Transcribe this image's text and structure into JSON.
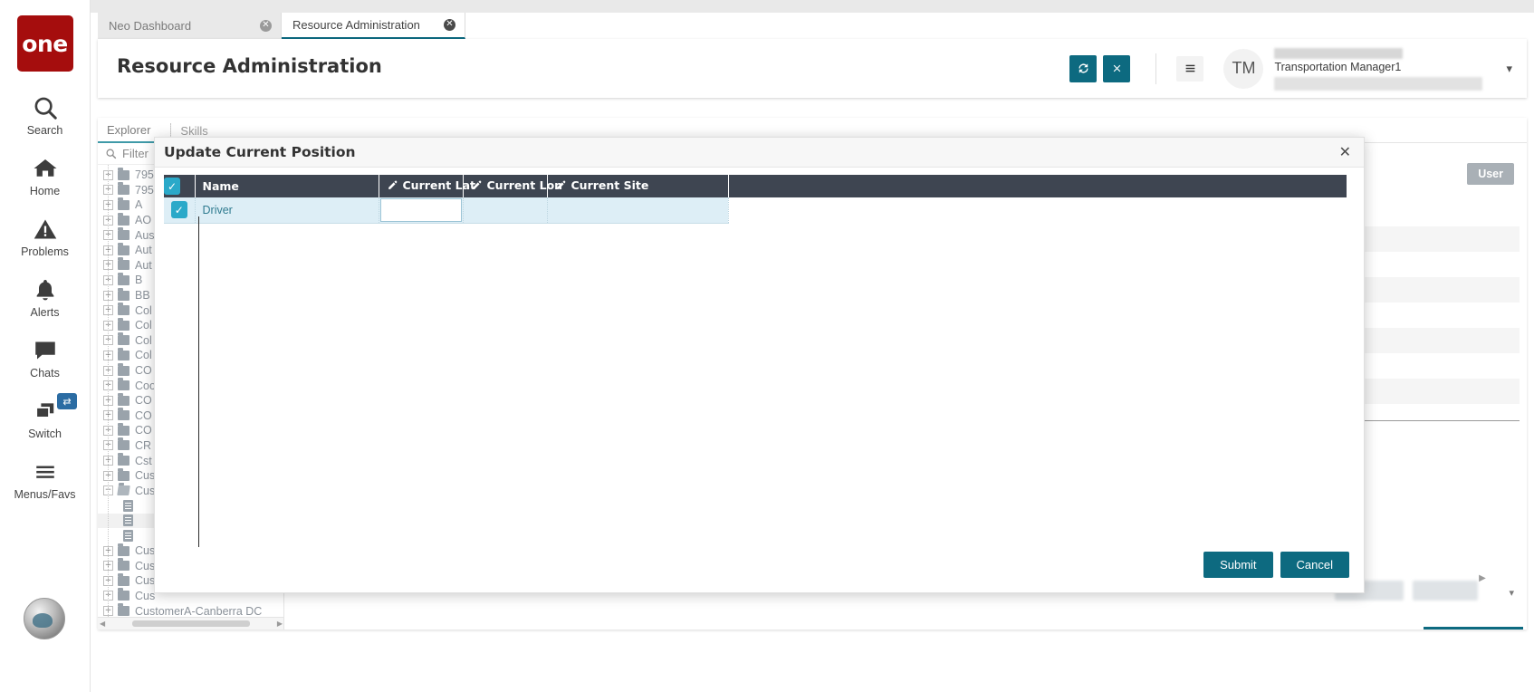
{
  "brand": {
    "logo_text": "one",
    "accent": "#0d6a80",
    "logo_bg": "#a50d0d"
  },
  "rail": {
    "items": [
      {
        "label": "Search",
        "icon": "search-icon"
      },
      {
        "label": "Home",
        "icon": "home-icon"
      },
      {
        "label": "Problems",
        "icon": "warning-icon"
      },
      {
        "label": "Alerts",
        "icon": "bell-icon"
      },
      {
        "label": "Chats",
        "icon": "chat-icon"
      },
      {
        "label": "Switch",
        "icon": "switch-icon",
        "badge": "⇄"
      },
      {
        "label": "Menus/Favs",
        "icon": "hamburger-icon"
      }
    ]
  },
  "tabs": [
    {
      "label": "Neo Dashboard",
      "active": false
    },
    {
      "label": "Resource Administration",
      "active": true
    }
  ],
  "header": {
    "title": "Resource Administration",
    "refresh_label": "↻",
    "close_label": "✕",
    "menu_label": "☰",
    "avatar_initials": "TM",
    "user_name": "Transportation Manager1",
    "caret": "▾"
  },
  "panel_tabs": [
    {
      "label": "Explorer",
      "active": true
    },
    {
      "label": "Skills",
      "active": false
    }
  ],
  "explorer": {
    "filter_placeholder": "Filter",
    "search_icon": "search-icon",
    "nodes": [
      {
        "label": "795",
        "type": "folder",
        "level": 0
      },
      {
        "label": "795",
        "type": "folder",
        "level": 0
      },
      {
        "label": "A",
        "type": "folder",
        "level": 0
      },
      {
        "label": "AO",
        "type": "folder",
        "level": 0
      },
      {
        "label": "Aus",
        "type": "folder",
        "level": 0
      },
      {
        "label": "Aut",
        "type": "folder",
        "level": 0
      },
      {
        "label": "Aut",
        "type": "folder",
        "level": 0
      },
      {
        "label": "B",
        "type": "folder",
        "level": 0
      },
      {
        "label": "BB",
        "type": "folder",
        "level": 0
      },
      {
        "label": "Col",
        "type": "folder",
        "level": 0
      },
      {
        "label": "Col",
        "type": "folder",
        "level": 0
      },
      {
        "label": "Col",
        "type": "folder",
        "level": 0
      },
      {
        "label": "Col",
        "type": "folder",
        "level": 0
      },
      {
        "label": "CO",
        "type": "folder",
        "level": 0
      },
      {
        "label": "Coo",
        "type": "folder",
        "level": 0
      },
      {
        "label": "CO",
        "type": "folder",
        "level": 0
      },
      {
        "label": "CO",
        "type": "folder",
        "level": 0
      },
      {
        "label": "CO",
        "type": "folder",
        "level": 0
      },
      {
        "label": "CR",
        "type": "folder",
        "level": 0
      },
      {
        "label": "Cst",
        "type": "folder",
        "level": 0
      },
      {
        "label": "Cus",
        "type": "folder",
        "level": 0
      },
      {
        "label": "Cus",
        "type": "folder-open",
        "level": 0
      },
      {
        "label": "",
        "type": "document",
        "level": 1
      },
      {
        "label": "",
        "type": "document",
        "level": 1,
        "highlight": true
      },
      {
        "label": "",
        "type": "document",
        "level": 1
      },
      {
        "label": "Cus",
        "type": "folder",
        "level": 0
      },
      {
        "label": "Cus",
        "type": "folder",
        "level": 0
      },
      {
        "label": "Cus",
        "type": "folder",
        "level": 0
      },
      {
        "label": "Cus",
        "type": "folder",
        "level": 0
      },
      {
        "label": "CustomerA-Canberra DC",
        "type": "folder",
        "level": 0
      }
    ]
  },
  "background_panel": {
    "user_button_label": "User",
    "options_caret": "▾",
    "page_next_arrow": "▶"
  },
  "modal": {
    "title": "Update Current Position",
    "close_label": "✕",
    "columns": [
      {
        "key": "select",
        "label": "",
        "editable": false
      },
      {
        "key": "name",
        "label": "Name",
        "editable": false
      },
      {
        "key": "current_lat",
        "label": "Current Lat",
        "editable": true
      },
      {
        "key": "current_lon",
        "label": "Current Lon",
        "editable": true
      },
      {
        "key": "current_site",
        "label": "Current Site",
        "editable": true
      }
    ],
    "header_select_all_checked": true,
    "rows": [
      {
        "selected": true,
        "name": "Driver",
        "current_lat": "",
        "current_lon": "",
        "current_site": ""
      }
    ],
    "submit_label": "Submit",
    "cancel_label": "Cancel"
  }
}
